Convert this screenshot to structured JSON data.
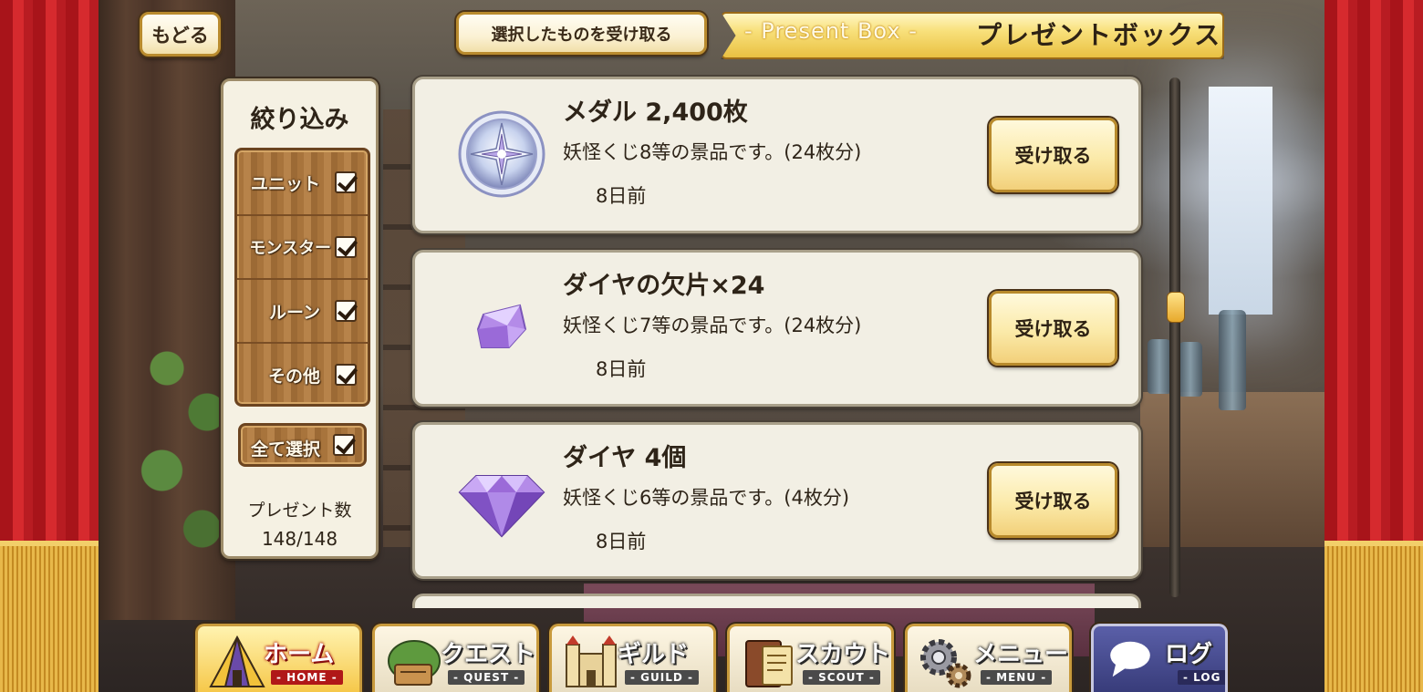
{
  "header": {
    "back_label": "もどる",
    "receive_selected_label": "選択したものを受け取る",
    "title_en": "- Present Box -",
    "title_jp": "プレゼントボックス"
  },
  "filter": {
    "title": "絞り込み",
    "options": [
      {
        "label": "ユニット",
        "checked": true
      },
      {
        "label": "モンスター",
        "checked": true
      },
      {
        "label": "ルーン",
        "checked": true
      },
      {
        "label": "その他",
        "checked": true
      }
    ],
    "select_all_label": "全て選択",
    "select_all_checked": true,
    "count_label": "プレゼント数",
    "count_value": "148/148"
  },
  "presents": [
    {
      "name": "メダル 2,400枚",
      "desc": "妖怪くじ8等の景品です。(24枚分)",
      "time": "8日前",
      "button": "受け取る",
      "icon": "medal-icon"
    },
    {
      "name": "ダイヤの欠片×24",
      "desc": "妖怪くじ7等の景品です。(24枚分)",
      "time": "8日前",
      "button": "受け取る",
      "icon": "diamond-shard-icon"
    },
    {
      "name": "ダイヤ 4個",
      "desc": "妖怪くじ6等の景品です。(4枚分)",
      "time": "8日前",
      "button": "受け取る",
      "icon": "diamond-icon"
    }
  ],
  "nav": [
    {
      "jp": "ホーム",
      "en": "- HOME -",
      "icon": "home-tent-icon",
      "active": true
    },
    {
      "jp": "クエスト",
      "en": "- QUEST -",
      "icon": "quest-map-icon",
      "active": false
    },
    {
      "jp": "ギルド",
      "en": "- GUILD -",
      "icon": "guild-castle-icon",
      "active": false
    },
    {
      "jp": "スカウト",
      "en": "- SCOUT -",
      "icon": "scout-book-icon",
      "active": false
    },
    {
      "jp": "メニュー",
      "en": "- MENU -",
      "icon": "gear-icon",
      "active": false
    },
    {
      "jp": "ログ",
      "en": "- LOG -",
      "icon": "chat-bubble-icon",
      "active": false
    }
  ],
  "colors": {
    "curtain": "#c41e24",
    "gold": "#e9c042",
    "panel": "#f2efe4",
    "wood": "#a8743c"
  }
}
